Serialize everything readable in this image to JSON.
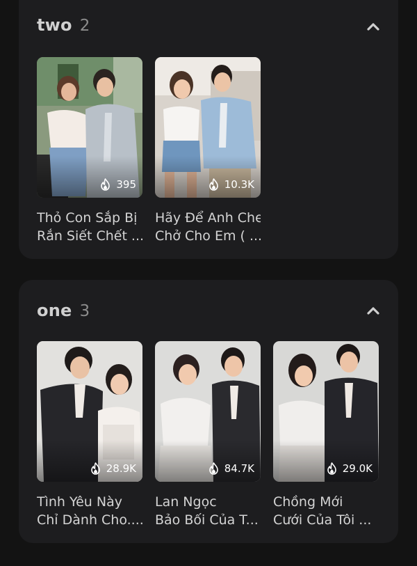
{
  "groups": [
    {
      "name": "two",
      "count": "2",
      "items": [
        {
          "views": "395",
          "title_line1": "Thỏ Con Sắp Bị",
          "title_line2": "Rắn Siết Chết ..."
        },
        {
          "views": "10.3K",
          "title_line1": "Hãy Để Anh Che",
          "title_line2": "Chở Cho Em ( ..."
        }
      ]
    },
    {
      "name": "one",
      "count": "3",
      "items": [
        {
          "views": "28.9K",
          "title_line1": "Tình Yêu Này",
          "title_line2": "Chỉ Dành Cho...."
        },
        {
          "views": "84.7K",
          "title_line1": "Lan Ngọc",
          "title_line2": "Bảo Bối Của T..."
        },
        {
          "views": "29.0K",
          "title_line1": "Chồng Mới",
          "title_line2": "Cưới Của Tôi ..."
        }
      ]
    }
  ],
  "icons": {
    "collapse": "chevron-up-icon",
    "views": "flame-icon"
  },
  "colors": {
    "background": "#131313",
    "card": "#1d1d1f",
    "text": "#d4d4d4",
    "muted": "#8c8c8c"
  }
}
